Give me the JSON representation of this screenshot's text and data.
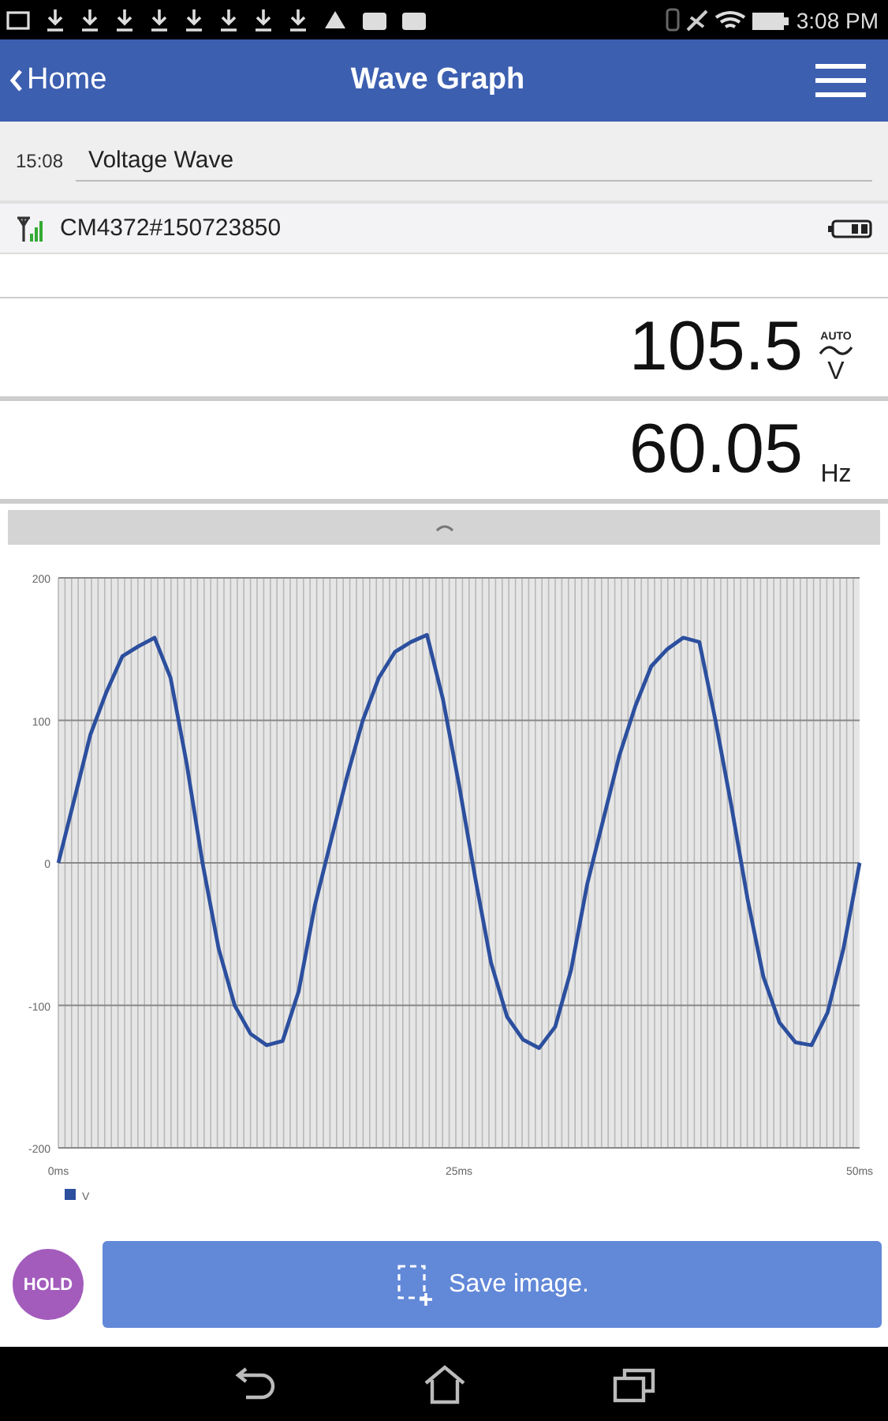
{
  "status_bar": {
    "time": "3:08 PM"
  },
  "header": {
    "back": "Home",
    "title": "Wave Graph"
  },
  "record": {
    "time": "15:08",
    "name": "Voltage Wave"
  },
  "device": {
    "name": "CM4372#150723850"
  },
  "readings": [
    {
      "value": "105.5",
      "mode": "AUTO",
      "ac": true,
      "unit": "V"
    },
    {
      "value": "60.05",
      "ac": false,
      "unit": "Hz"
    }
  ],
  "chart": {
    "chart_data": {
      "type": "line",
      "grid": true,
      "xlim": [
        0,
        50
      ],
      "ylim": [
        -200,
        200
      ],
      "xticks": [
        {
          "value": 0,
          "label": "0ms"
        },
        {
          "value": 25,
          "label": "25ms"
        },
        {
          "value": 50,
          "label": "50ms"
        }
      ],
      "yticks": [
        -200,
        -100,
        0,
        100,
        200
      ],
      "x": [
        0,
        1,
        2,
        3,
        4,
        5,
        6,
        7,
        8,
        9,
        10,
        11,
        12,
        13,
        14,
        15,
        16,
        17,
        18,
        19,
        20,
        21,
        22,
        23,
        24,
        25,
        26,
        27,
        28,
        29,
        30,
        31,
        32,
        33,
        34,
        35,
        36,
        37,
        38,
        39,
        40,
        41,
        42,
        43,
        44,
        45,
        46,
        47,
        48,
        49,
        50
      ],
      "series": [
        {
          "name": "V",
          "color": "#2c4f9e",
          "values": [
            0,
            45,
            90,
            120,
            145,
            152,
            158,
            130,
            70,
            0,
            -60,
            -100,
            -120,
            -128,
            -125,
            -90,
            -30,
            15,
            60,
            100,
            130,
            148,
            155,
            160,
            115,
            55,
            -10,
            -70,
            -108,
            -124,
            -130,
            -115,
            -75,
            -15,
            30,
            75,
            110,
            138,
            150,
            158,
            155,
            100,
            40,
            -25,
            -80,
            -112,
            -126,
            -128,
            -105,
            -60,
            0
          ]
        }
      ]
    }
  },
  "buttons": {
    "hold": "HOLD",
    "save": "Save image."
  }
}
